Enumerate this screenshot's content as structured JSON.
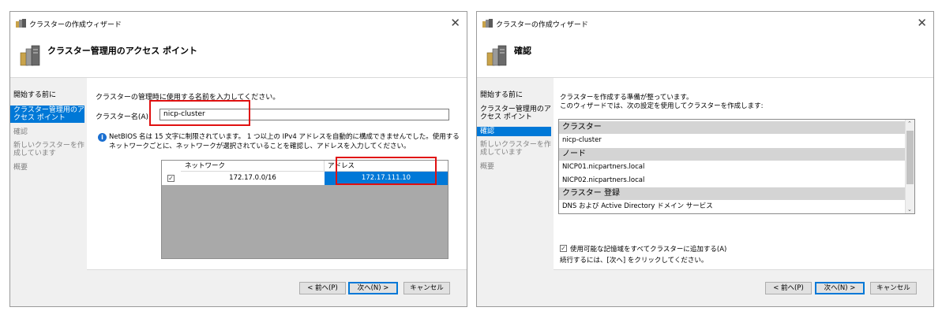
{
  "left_window": {
    "title": "クラスターの作成ウィザード",
    "header_title": "クラスター管理用のアクセス ポイント",
    "sidebar": [
      {
        "label": "開始する前に",
        "state": "normal"
      },
      {
        "label": "クラスター管理用のアクセス ポイント",
        "state": "active"
      },
      {
        "label": "確認",
        "state": "dim"
      },
      {
        "label": "新しいクラスターを作成しています",
        "state": "dim"
      },
      {
        "label": "概要",
        "state": "dim"
      }
    ],
    "instruction": "クラスターの管理時に使用する名前を入力してください。",
    "name_label": "クラスター名(A):",
    "name_value": "nicp-cluster",
    "info_text_1": "NetBIOS 名は 15 文字に制限されています。 1 つ以上の IPv4 アドレスを自動的に構成できませんでした。使用する",
    "info_text_2": "ネットワークごとに、ネットワークが選択されていることを確認し、アドレスを入力してください。",
    "table": {
      "columns": [
        "ネットワーク",
        "アドレス"
      ],
      "rows": [
        {
          "checked": true,
          "network": "172.17.0.0/16",
          "address": "172.17.111.10"
        }
      ]
    },
    "buttons": {
      "back": "< 前へ(P)",
      "next": "次へ(N) >",
      "cancel": "キャンセル"
    }
  },
  "right_window": {
    "title": "クラスターの作成ウィザード",
    "header_title": "確認",
    "sidebar": [
      {
        "label": "開始する前に",
        "state": "normal"
      },
      {
        "label": "クラスター管理用のアクセス ポイント",
        "state": "normal"
      },
      {
        "label": "確認",
        "state": "active"
      },
      {
        "label": "新しいクラスターを作成しています",
        "state": "dim"
      },
      {
        "label": "概要",
        "state": "dim"
      }
    ],
    "intro_1": "クラスターを作成する準備が整っています。",
    "intro_2": "このウィザードでは、次の設定を使用してクラスターを作成します:",
    "summary": [
      {
        "kind": "head",
        "text": "クラスター"
      },
      {
        "kind": "value",
        "text": "nicp-cluster"
      },
      {
        "kind": "head",
        "text": "ノード"
      },
      {
        "kind": "value",
        "text": "NICP01.nicpartners.local"
      },
      {
        "kind": "value",
        "text": "NICP02.nicpartners.local"
      },
      {
        "kind": "head",
        "text": "クラスター 登録"
      },
      {
        "kind": "value",
        "text": "DNS および Active Directory ドメイン サービス"
      }
    ],
    "storage_checkbox_label": "使用可能な記憶域をすべてクラスターに追加する(A)",
    "storage_checked": true,
    "continue_text": "続行するには、[次へ] をクリックしてください。",
    "buttons": {
      "back": "< 前へ(P)",
      "next": "次へ(N) >",
      "cancel": "キャンセル"
    }
  },
  "colors": {
    "accent": "#0078d7",
    "highlight_box": "#e01010",
    "table_bg": "#a9a9a9"
  }
}
